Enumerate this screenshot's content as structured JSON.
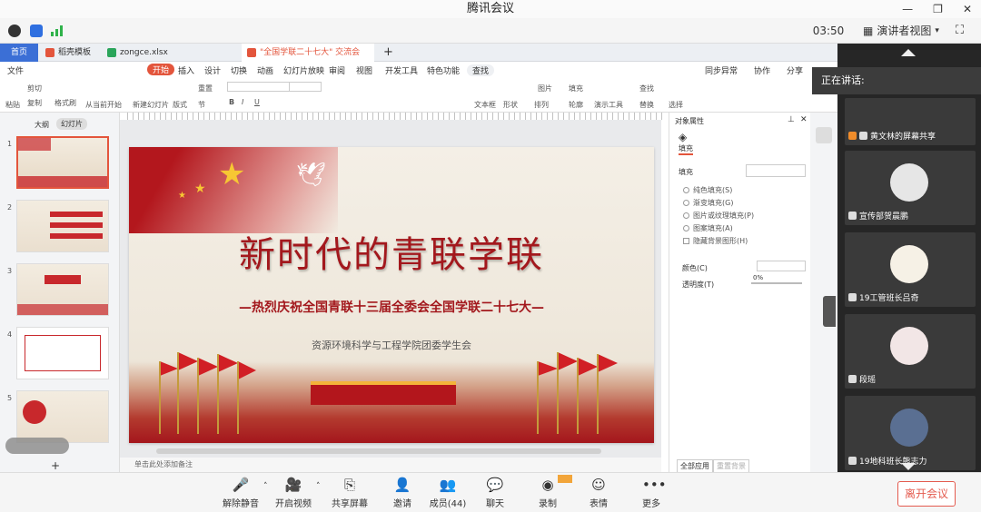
{
  "app_title": "腾讯会议",
  "meeting": {
    "timer": "03:50",
    "view_mode": "演讲者视图",
    "speaking_label": "正在讲话:",
    "participants": [
      {
        "name": "黄文林的屏幕共享"
      },
      {
        "name": "宣传部贺晨鹏"
      },
      {
        "name": "19工管班长吕奇"
      },
      {
        "name": "段瑶"
      },
      {
        "name": "19地科班长熊志力"
      }
    ]
  },
  "toolbar": {
    "mute": "解除静音",
    "video": "开启视频",
    "share": "共享屏幕",
    "invite": "邀请",
    "members": "成员(44)",
    "chat": "聊天",
    "record": "录制",
    "emoji": "表情",
    "more": "更多",
    "leave": "离开会议"
  },
  "wps": {
    "tabs": [
      "首页",
      "稻壳模板",
      "zongce.xlsx",
      "\"全国学联二十七大\" 交流会"
    ],
    "menu": [
      "文件",
      "开始",
      "插入",
      "设计",
      "切换",
      "动画",
      "幻灯片放映",
      "审阅",
      "视图",
      "开发工具",
      "特色功能",
      "查找"
    ],
    "menu_right": [
      "同步异常",
      "协作",
      "分享"
    ],
    "ribbon": [
      "粘贴",
      "剪切",
      "复制",
      "格式刷",
      "从当前开始",
      "新建幻灯片",
      "版式",
      "节",
      "重置",
      "文本框",
      "形状",
      "排列",
      "图片",
      "填充",
      "轮廓",
      "演示工具",
      "查找",
      "替换",
      "选择"
    ],
    "view_tabs": [
      "大纲",
      "幻灯片"
    ],
    "slide_numbers": [
      "1",
      "2",
      "3",
      "4",
      "5"
    ],
    "notes_placeholder": "单击此处添加备注",
    "slide": {
      "title": "新时代的青联学联",
      "subtitle": "—热烈庆祝全国青联十三届全委会全国学联二十七大—",
      "org": "资源环境科学与工程学院团委学生会"
    },
    "props": {
      "header": "对象属性",
      "tab": "填充",
      "section": "填充",
      "options": [
        "纯色填充(S)",
        "渐变填充(G)",
        "图片或纹理填充(P)",
        "图案填充(A)",
        "隐藏背景图形(H)"
      ],
      "color_label": "颜色(C)",
      "transparency_label": "透明度(T)",
      "transparency_value": "0%",
      "apply_all": "全部应用",
      "reset_bg": "重置背景"
    }
  }
}
